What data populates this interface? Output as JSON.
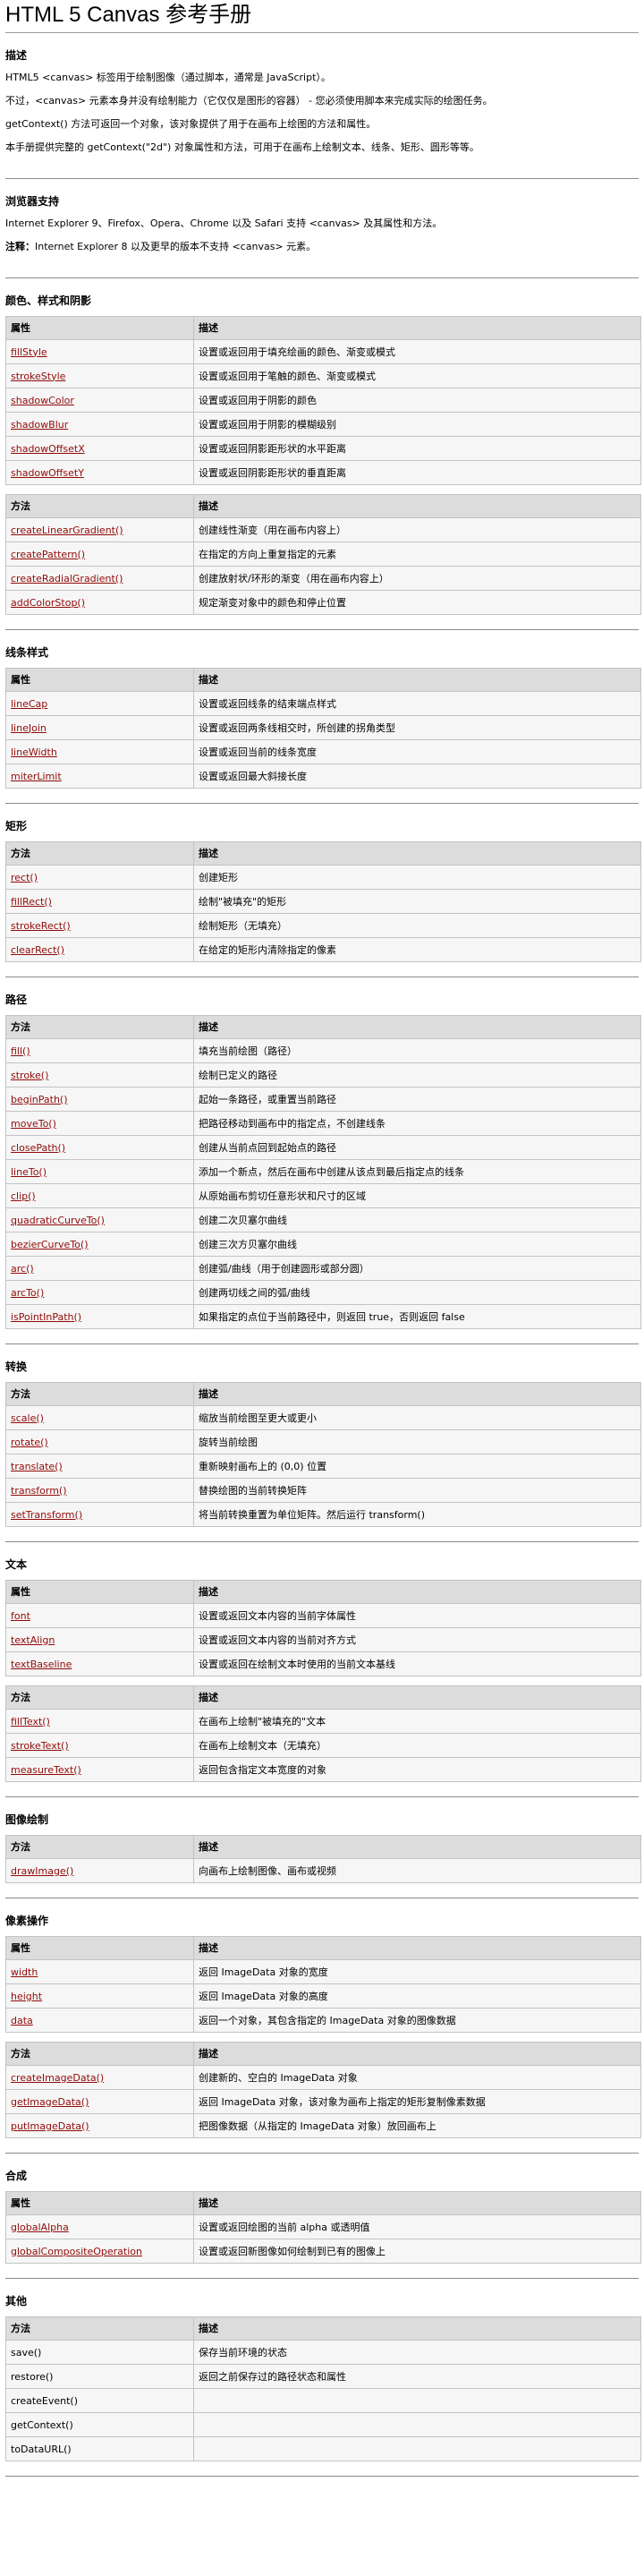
{
  "title": "HTML 5 Canvas 参考手册",
  "desc": {
    "heading": "描述",
    "paras": [
      "HTML5 <canvas> 标签用于绘制图像（通过脚本，通常是 JavaScript）。",
      "不过，<canvas> 元素本身并没有绘制能力（它仅仅是图形的容器） - 您必须使用脚本来完成实际的绘图任务。",
      "getContext() 方法可返回一个对象，该对象提供了用于在画布上绘图的方法和属性。",
      "本手册提供完整的 getContext(\"2d\") 对象属性和方法，可用于在画布上绘制文本、线条、矩形、圆形等等。"
    ]
  },
  "browser": {
    "heading": "浏览器支持",
    "para": "Internet Explorer 9、Firefox、Opera、Chrome 以及 Safari 支持 <canvas> 及其属性和方法。",
    "note_label": "注释：",
    "note_text": "Internet Explorer 8 以及更早的版本不支持 <canvas> 元素。"
  },
  "sections": [
    {
      "heading": "颜色、样式和阴影",
      "tables": [
        {
          "h1": "属性",
          "h2": "描述",
          "rows": [
            {
              "name": "fillStyle",
              "link": true,
              "desc": "设置或返回用于填充绘画的颜色、渐变或模式"
            },
            {
              "name": "strokeStyle",
              "link": true,
              "desc": "设置或返回用于笔触的颜色、渐变或模式"
            },
            {
              "name": "shadowColor",
              "link": true,
              "desc": "设置或返回用于阴影的颜色"
            },
            {
              "name": "shadowBlur",
              "link": true,
              "desc": "设置或返回用于阴影的模糊级别"
            },
            {
              "name": "shadowOffsetX",
              "link": true,
              "desc": "设置或返回阴影距形状的水平距离"
            },
            {
              "name": "shadowOffsetY",
              "link": true,
              "desc": "设置或返回阴影距形状的垂直距离"
            }
          ]
        },
        {
          "h1": "方法",
          "h2": "描述",
          "rows": [
            {
              "name": "createLinearGradient()",
              "link": true,
              "desc": "创建线性渐变（用在画布内容上）"
            },
            {
              "name": "createPattern()",
              "link": true,
              "desc": "在指定的方向上重复指定的元素"
            },
            {
              "name": "createRadialGradient()",
              "link": true,
              "desc": "创建放射状/环形的渐变（用在画布内容上）"
            },
            {
              "name": "addColorStop()",
              "link": true,
              "desc": "规定渐变对象中的颜色和停止位置"
            }
          ]
        }
      ]
    },
    {
      "heading": "线条样式",
      "tables": [
        {
          "h1": "属性",
          "h2": "描述",
          "rows": [
            {
              "name": "lineCap",
              "link": true,
              "desc": "设置或返回线条的结束端点样式"
            },
            {
              "name": "lineJoin",
              "link": true,
              "desc": "设置或返回两条线相交时，所创建的拐角类型"
            },
            {
              "name": "lineWidth",
              "link": true,
              "desc": "设置或返回当前的线条宽度"
            },
            {
              "name": "miterLimit",
              "link": true,
              "desc": "设置或返回最大斜接长度"
            }
          ]
        }
      ]
    },
    {
      "heading": "矩形",
      "tables": [
        {
          "h1": "方法",
          "h2": "描述",
          "rows": [
            {
              "name": "rect()",
              "link": true,
              "desc": "创建矩形"
            },
            {
              "name": "fillRect()",
              "link": true,
              "desc": "绘制\"被填充\"的矩形"
            },
            {
              "name": "strokeRect()",
              "link": true,
              "desc": "绘制矩形（无填充）"
            },
            {
              "name": "clearRect()",
              "link": true,
              "desc": "在给定的矩形内清除指定的像素"
            }
          ]
        }
      ]
    },
    {
      "heading": "路径",
      "tables": [
        {
          "h1": "方法",
          "h2": "描述",
          "rows": [
            {
              "name": "fill()",
              "link": true,
              "desc": "填充当前绘图（路径）"
            },
            {
              "name": "stroke()",
              "link": true,
              "desc": "绘制已定义的路径"
            },
            {
              "name": "beginPath()",
              "link": true,
              "desc": "起始一条路径，或重置当前路径"
            },
            {
              "name": "moveTo()",
              "link": true,
              "desc": "把路径移动到画布中的指定点，不创建线条"
            },
            {
              "name": "closePath()",
              "link": true,
              "desc": "创建从当前点回到起始点的路径"
            },
            {
              "name": "lineTo()",
              "link": true,
              "desc": "添加一个新点，然后在画布中创建从该点到最后指定点的线条"
            },
            {
              "name": "clip()",
              "link": true,
              "desc": "从原始画布剪切任意形状和尺寸的区域"
            },
            {
              "name": "quadraticCurveTo()",
              "link": true,
              "desc": "创建二次贝塞尔曲线"
            },
            {
              "name": "bezierCurveTo()",
              "link": true,
              "desc": "创建三次方贝塞尔曲线"
            },
            {
              "name": "arc()",
              "link": true,
              "desc": "创建弧/曲线（用于创建圆形或部分圆）"
            },
            {
              "name": "arcTo()",
              "link": true,
              "desc": "创建两切线之间的弧/曲线"
            },
            {
              "name": "isPointInPath()",
              "link": true,
              "desc": "如果指定的点位于当前路径中，则返回 true，否则返回 false"
            }
          ]
        }
      ]
    },
    {
      "heading": "转换",
      "tables": [
        {
          "h1": "方法",
          "h2": "描述",
          "rows": [
            {
              "name": "scale()",
              "link": true,
              "desc": "缩放当前绘图至更大或更小"
            },
            {
              "name": "rotate()",
              "link": true,
              "desc": "旋转当前绘图"
            },
            {
              "name": "translate()",
              "link": true,
              "desc": "重新映射画布上的 (0,0) 位置"
            },
            {
              "name": "transform()",
              "link": true,
              "desc": "替换绘图的当前转换矩阵"
            },
            {
              "name": "setTransform()",
              "link": true,
              "desc": "将当前转换重置为单位矩阵。然后运行 transform()"
            }
          ]
        }
      ]
    },
    {
      "heading": "文本",
      "tables": [
        {
          "h1": "属性",
          "h2": "描述",
          "rows": [
            {
              "name": "font",
              "link": true,
              "desc": "设置或返回文本内容的当前字体属性"
            },
            {
              "name": "textAlign",
              "link": true,
              "desc": "设置或返回文本内容的当前对齐方式"
            },
            {
              "name": "textBaseline",
              "link": true,
              "desc": "设置或返回在绘制文本时使用的当前文本基线"
            }
          ]
        },
        {
          "h1": "方法",
          "h2": "描述",
          "rows": [
            {
              "name": "fillText()",
              "link": true,
              "desc": "在画布上绘制\"被填充的\"文本"
            },
            {
              "name": "strokeText()",
              "link": true,
              "desc": "在画布上绘制文本（无填充）"
            },
            {
              "name": "measureText()",
              "link": true,
              "desc": "返回包含指定文本宽度的对象"
            }
          ]
        }
      ]
    },
    {
      "heading": "图像绘制",
      "tables": [
        {
          "h1": "方法",
          "h2": "描述",
          "rows": [
            {
              "name": "drawImage()",
              "link": true,
              "desc": "向画布上绘制图像、画布或视频"
            }
          ]
        }
      ]
    },
    {
      "heading": "像素操作",
      "tables": [
        {
          "h1": "属性",
          "h2": "描述",
          "rows": [
            {
              "name": "width",
              "link": true,
              "desc": "返回 ImageData 对象的宽度"
            },
            {
              "name": "height",
              "link": true,
              "desc": "返回 ImageData 对象的高度"
            },
            {
              "name": "data",
              "link": true,
              "desc": "返回一个对象，其包含指定的 ImageData 对象的图像数据"
            }
          ]
        },
        {
          "h1": "方法",
          "h2": "描述",
          "rows": [
            {
              "name": "createImageData()",
              "link": true,
              "desc": "创建新的、空白的 ImageData 对象"
            },
            {
              "name": "getImageData()",
              "link": true,
              "desc": "返回 ImageData 对象，该对象为画布上指定的矩形复制像素数据"
            },
            {
              "name": "putImageData()",
              "link": true,
              "desc": "把图像数据（从指定的 ImageData 对象）放回画布上"
            }
          ]
        }
      ]
    },
    {
      "heading": "合成",
      "tables": [
        {
          "h1": "属性",
          "h2": "描述",
          "rows": [
            {
              "name": "globalAlpha",
              "link": true,
              "desc": "设置或返回绘图的当前 alpha 或透明值"
            },
            {
              "name": "globalCompositeOperation",
              "link": true,
              "desc": "设置或返回新图像如何绘制到已有的图像上"
            }
          ]
        }
      ]
    },
    {
      "heading": "其他",
      "tables": [
        {
          "h1": "方法",
          "h2": "描述",
          "rows": [
            {
              "name": "save()",
              "link": false,
              "desc": "保存当前环境的状态"
            },
            {
              "name": "restore()",
              "link": false,
              "desc": "返回之前保存过的路径状态和属性"
            },
            {
              "name": "createEvent()",
              "link": false,
              "desc": ""
            },
            {
              "name": "getContext()",
              "link": false,
              "desc": ""
            },
            {
              "name": "toDataURL()",
              "link": false,
              "desc": ""
            }
          ]
        }
      ]
    }
  ]
}
